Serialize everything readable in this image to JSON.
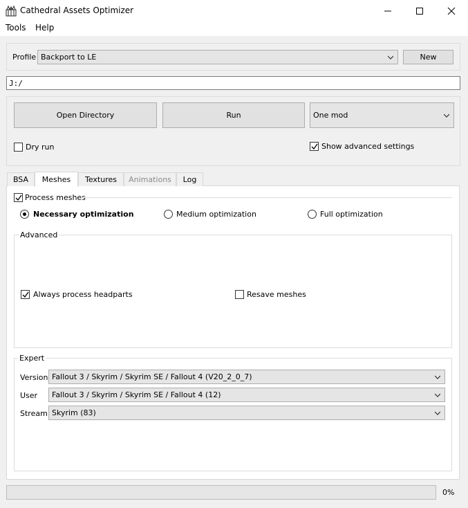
{
  "window": {
    "title": "Cathedral Assets Optimizer"
  },
  "menu": {
    "tools": "Tools",
    "help": "Help"
  },
  "profile": {
    "label": "Profile",
    "selected": "Backport to LE",
    "new_button": "New"
  },
  "path": {
    "value": "J:/"
  },
  "actions": {
    "open_directory": "Open Directory",
    "run": "Run",
    "mode_selected": "One mod",
    "dry_run": "Dry run",
    "dry_run_checked": false,
    "show_advanced": "Show advanced settings",
    "show_advanced_checked": true
  },
  "tabs": [
    {
      "label": "BSA",
      "active": false,
      "enabled": true
    },
    {
      "label": "Meshes",
      "active": true,
      "enabled": true
    },
    {
      "label": "Textures",
      "active": false,
      "enabled": true
    },
    {
      "label": "Animations",
      "active": false,
      "enabled": false
    },
    {
      "label": "Log",
      "active": false,
      "enabled": true
    }
  ],
  "meshes": {
    "process_meshes": "Process meshes",
    "process_meshes_checked": true,
    "optimization": {
      "necessary": "Necessary optimization",
      "medium": "Medium optimization",
      "full": "Full optimization",
      "selected": "necessary"
    },
    "advanced": {
      "title": "Advanced",
      "always_process_headparts": "Always process headparts",
      "always_process_headparts_checked": true,
      "resave_meshes": "Resave meshes",
      "resave_meshes_checked": false
    },
    "expert": {
      "title": "Expert",
      "version_label": "Version",
      "version_value": "Fallout 3 / Skyrim / Skyrim SE / Fallout 4 (V20_2_0_7)",
      "user_label": "User",
      "user_value": "Fallout 3 / Skyrim / Skyrim SE / Fallout 4 (12)",
      "stream_label": "Stream",
      "stream_value": "Skyrim (83)"
    }
  },
  "progress": {
    "value": 0,
    "text": "0%"
  }
}
